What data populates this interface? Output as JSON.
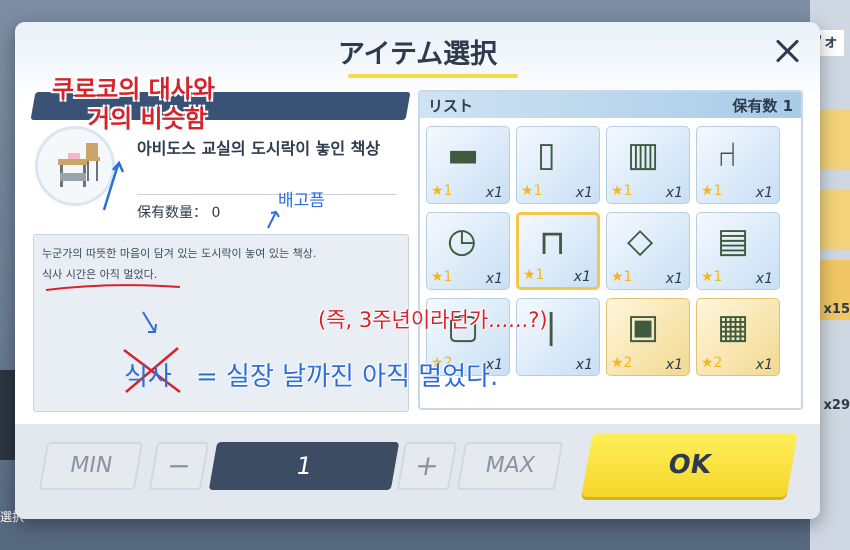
{
  "background": {
    "top_right_tab": "フォ",
    "side_numbers": [
      "x15",
      "x29"
    ],
    "bottom_left_text": "選択"
  },
  "dialog": {
    "title": "アイテム選択",
    "item": {
      "name": "아비도스 교실의 도시락이 놓인 책상",
      "owned_label": "保有数量：",
      "owned_value": "0",
      "description_line1": "누군가의 따뜻한 마음이 담겨 있는 도시락이 놓여 있는 책상.",
      "description_line2": "식사 시간은 아직 멀었다."
    },
    "list": {
      "label": "リスト",
      "owned_label": "保有数",
      "owned_count": "1",
      "items": [
        {
          "icon": "chalkboard-icon",
          "rarity": "1",
          "qty": "x1",
          "tier": "blue"
        },
        {
          "icon": "locker-icon",
          "rarity": "1",
          "qty": "x1",
          "tier": "blue"
        },
        {
          "icon": "cabinet-icon",
          "rarity": "1",
          "qty": "x1",
          "tier": "blue"
        },
        {
          "icon": "chair-icon",
          "rarity": "1",
          "qty": "x1",
          "tier": "blue"
        },
        {
          "icon": "clock-icon",
          "rarity": "1",
          "qty": "x1",
          "tier": "blue"
        },
        {
          "icon": "desk-icon",
          "rarity": "1",
          "qty": "x1",
          "tier": "blue"
        },
        {
          "icon": "floor-mat-icon",
          "rarity": "1",
          "qty": "x1",
          "tier": "blue"
        },
        {
          "icon": "shelf-icon",
          "rarity": "1",
          "qty": "x1",
          "tier": "blue"
        },
        {
          "icon": "poster-icon",
          "rarity": "2",
          "qty": "x1",
          "tier": "blue"
        },
        {
          "icon": "pole-icon",
          "rarity": "",
          "qty": "x1",
          "tier": "blue"
        },
        {
          "icon": "notice-board-icon",
          "rarity": "2",
          "qty": "x1",
          "tier": "gold"
        },
        {
          "icon": "bulletin-board-icon",
          "rarity": "2",
          "qty": "x1",
          "tier": "gold"
        }
      ]
    },
    "controls": {
      "min_label": "MIN",
      "minus_label": "−",
      "quantity": "1",
      "plus_label": "+",
      "max_label": "MAX",
      "ok_label": "OK"
    }
  },
  "annotations": {
    "red_title_line1": "쿠로코의 대사와",
    "red_title_line2": "거의 비슷함",
    "hungry": "배고픔",
    "red_aside": "(즉, 3주년이라던가......?)",
    "crossed_word": "식사",
    "equation": "= 실장 날까진 아직 멀었다."
  },
  "colors": {
    "dialog_bg": "#ffffff",
    "header_navy": "#3a5275",
    "ok_yellow": "#f5d62a",
    "annotation_red": "#d8222a",
    "annotation_blue": "#2d6fd6"
  }
}
